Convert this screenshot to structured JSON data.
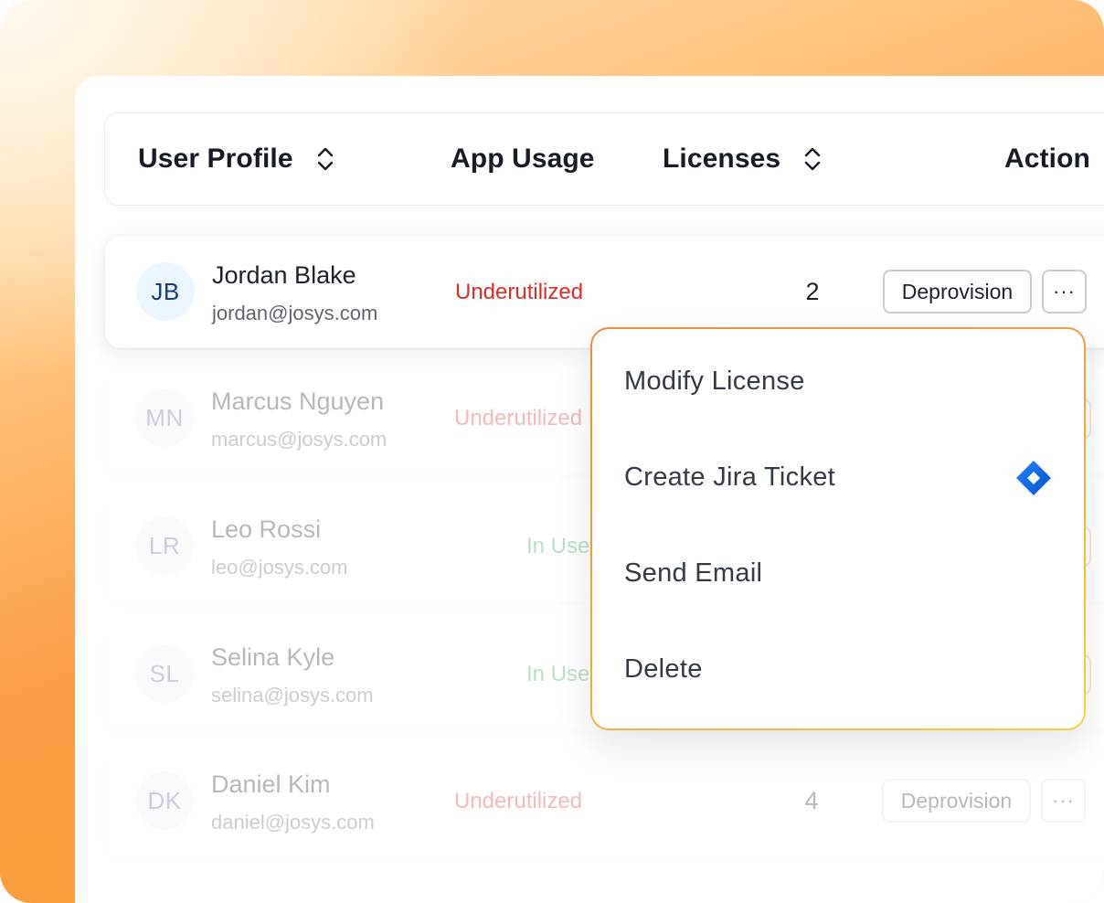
{
  "table": {
    "headers": {
      "user_profile": "User Profile",
      "app_usage": "App Usage",
      "licenses": "Licenses",
      "action": "Action"
    },
    "rows": [
      {
        "initials": "JB",
        "name": "Jordan Blake",
        "email": "jordan@josys.com",
        "usage": "Underutilized",
        "usage_status": "under",
        "licenses": "2",
        "action_label": "Deprovision",
        "more_label": "···"
      },
      {
        "initials": "MN",
        "name": "Marcus Nguyen",
        "email": "marcus@josys.com",
        "usage": "Underutilized",
        "usage_status": "under"
      },
      {
        "initials": "LR",
        "name": "Leo Rossi",
        "email": "leo@josys.com",
        "usage": "In Use",
        "usage_status": "inuse"
      },
      {
        "initials": "SL",
        "name": "Selina Kyle",
        "email": "selina@josys.com",
        "usage": "In Use",
        "usage_status": "inuse"
      },
      {
        "initials": "DK",
        "name": "Daniel Kim",
        "email": "daniel@josys.com",
        "usage": "Underutilized",
        "usage_status": "under",
        "licenses": "4",
        "action_label": "Deprovision",
        "more_label": "···"
      }
    ]
  },
  "dropdown": {
    "items": [
      {
        "label": "Modify License"
      },
      {
        "label": "Create Jira Ticket",
        "icon": "jira-icon"
      },
      {
        "label": "Send Email"
      },
      {
        "label": "Delete"
      }
    ]
  },
  "colors": {
    "underutilized": "#d92d2a",
    "in_use": "#2e9e4c",
    "accent_orange": "#fb9d44",
    "jira_blue": "#2684ff"
  }
}
